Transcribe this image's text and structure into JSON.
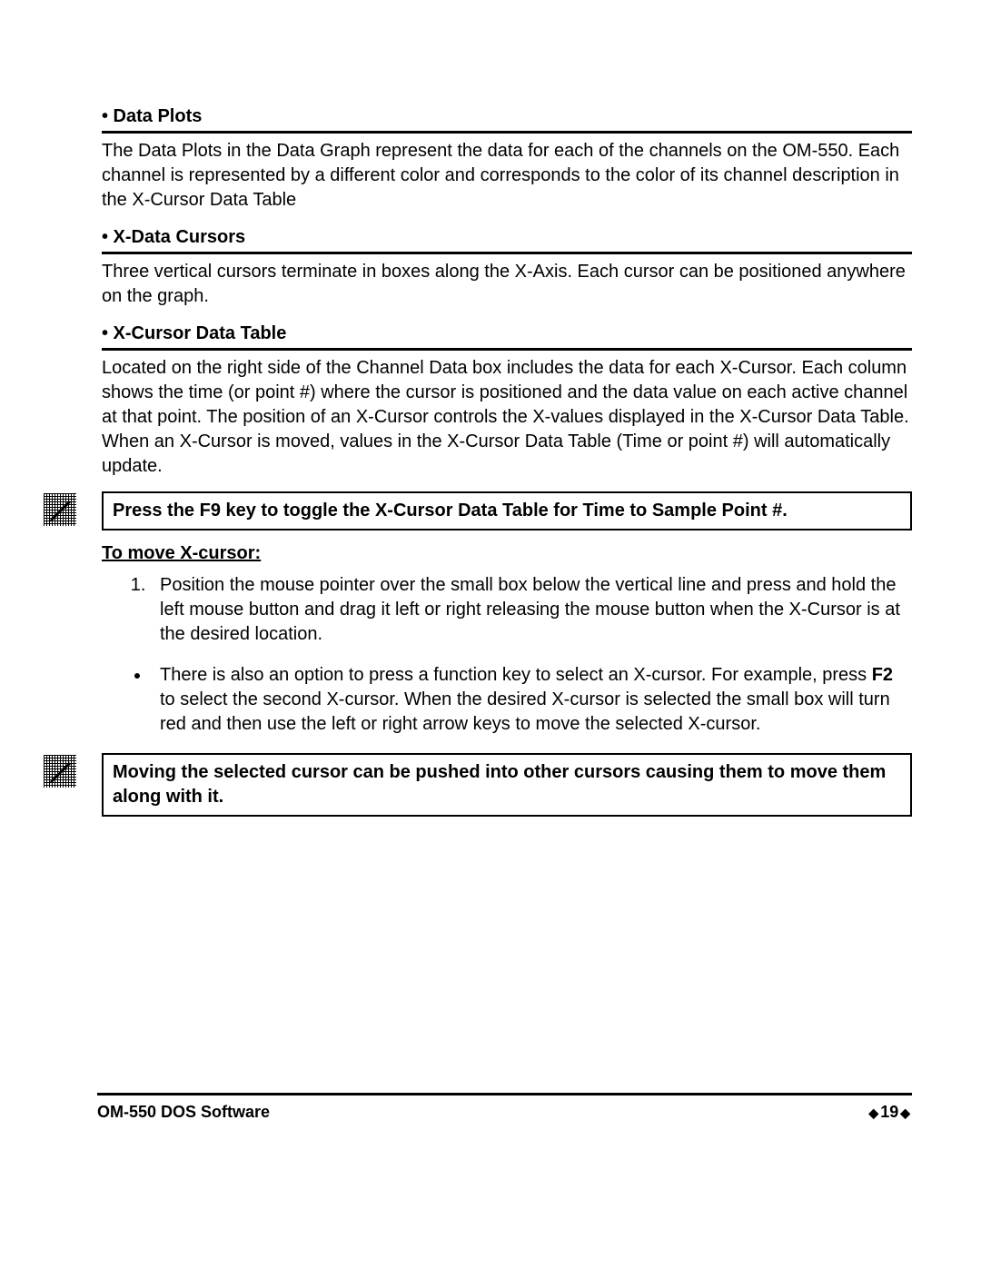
{
  "sections": [
    {
      "heading": "• Data Plots",
      "body": "The Data Plots in the Data Graph represent the data for each of the channels on the OM-550. Each channel is represented by a different color and corresponds to the color of its channel description in the X-Cursor Data Table"
    },
    {
      "heading": "• X-Data Cursors",
      "body": "Three vertical cursors terminate in boxes along the X-Axis. Each cursor can be positioned anywhere on the graph."
    },
    {
      "heading": "• X-Cursor Data Table",
      "body": "Located on the right side of the Channel Data box includes the data for each X-Cursor. Each column shows the time (or point #) where the cursor is positioned and the data value on each active channel at that point. The position of an X-Cursor controls the X-values displayed in the X-Cursor Data Table. When an X-Cursor is moved, values in the X-Cursor Data Table (Time or point #) will automatically update."
    }
  ],
  "note1": "Press the F9 key to toggle the X-Cursor Data Table for Time to Sample Point #.",
  "moveHeading": "To move X-cursor:",
  "steps": {
    "item1": "Position the mouse pointer over the small box below the vertical line and press and hold the left mouse button and drag it left or right releasing the mouse button when the X-Cursor is at the desired location.",
    "item2a": "There is also an option to press a function key to select an X-cursor. For example, press ",
    "item2bold": "F2",
    "item2b": " to select the second X-cursor. When the desired X-cursor is selected the small box will turn red and then use the left or right arrow keys to move the selected X-cursor."
  },
  "note2": "Moving the selected cursor can be pushed into other cursors causing them to move them along with it.",
  "footer": {
    "left": "OM-550 DOS Software",
    "pageNum": "19"
  }
}
